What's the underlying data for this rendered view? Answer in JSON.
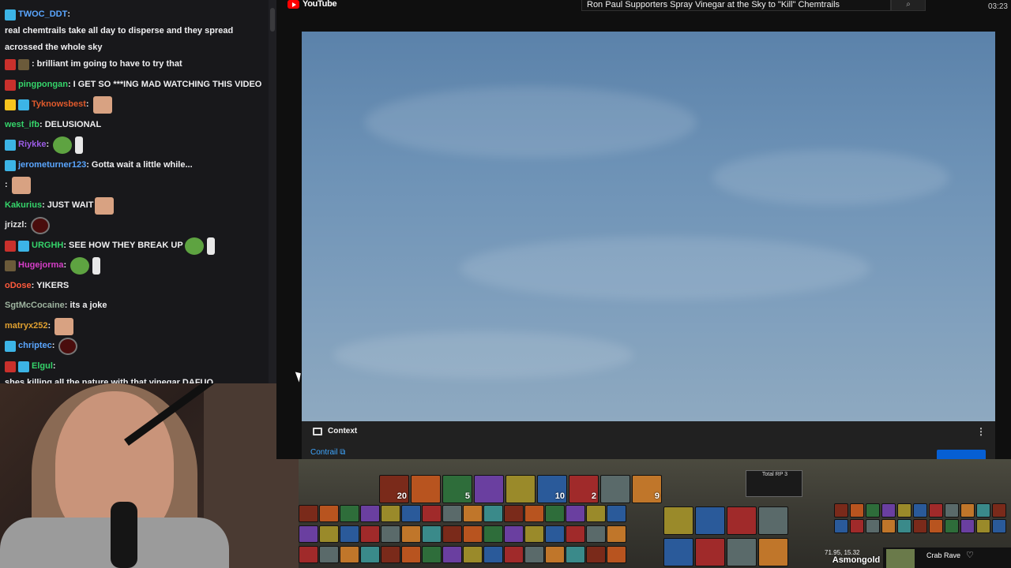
{
  "chat": {
    "messages": [
      {
        "badges": [
          "sub"
        ],
        "user": "TWOC_DDT",
        "color": "#5aa6ff",
        "text": "real chemtrails take all day to disperse and they spread acrossed the whole sky",
        "emotes": []
      },
      {
        "badges": [
          "mod",
          "year"
        ],
        "user": "",
        "color": "#444444",
        "text": "brilliant im going to have to try that",
        "emotes": []
      },
      {
        "badges": [
          "mod"
        ],
        "user": "pingpongan",
        "color": "#35d46a",
        "text": "I GET SO ***ING MAD WATCHING THIS VIDEO",
        "emotes": []
      },
      {
        "badges": [
          "gold",
          "sub"
        ],
        "user": "Tyknowsbest",
        "color": "#e05a2c",
        "text": "",
        "emotes": [
          "face"
        ]
      },
      {
        "badges": [],
        "user": "west_ifb",
        "color": "#35d46a",
        "text": "DELUSIONAL",
        "emotes": []
      },
      {
        "badges": [
          "sub"
        ],
        "user": "Riykke",
        "color": "#9b5ce6",
        "text": "",
        "emotes": [
          "pepe",
          "feather"
        ]
      },
      {
        "badges": [
          "sub"
        ],
        "user": "jerometurner123",
        "color": "#5aa6ff",
        "text": "Gotta wait a little while...",
        "emotes": []
      },
      {
        "badges": [],
        "user": "",
        "color": "#b22222",
        "text": "",
        "emotes": [
          "face"
        ]
      },
      {
        "badges": [],
        "user": "Kakurius",
        "color": "#35d46a",
        "text": "JUST WAIT",
        "emotes": [
          "face"
        ]
      },
      {
        "badges": [],
        "user": "jrizzl",
        "color": "#e0e0e0",
        "text": "",
        "emotes": [
          "orb"
        ]
      },
      {
        "badges": [
          "mod",
          "sub"
        ],
        "user": "URGHH",
        "color": "#35d46a",
        "text": "SEE HOW THEY BREAK UP",
        "emotes": [
          "pepe",
          "feather"
        ]
      },
      {
        "badges": [
          "year"
        ],
        "user": "Hugejorma",
        "color": "#d63ec8",
        "text": "",
        "emotes": [
          "pepe",
          "feather"
        ]
      },
      {
        "badges": [],
        "user": "oDose",
        "color": "#ff5a3c",
        "text": "YIKERS",
        "emotes": []
      },
      {
        "badges": [],
        "user": "SgtMcCocaine",
        "color": "#9fb4a0",
        "text": "its a joke",
        "emotes": []
      },
      {
        "badges": [],
        "user": "matryx252",
        "color": "#e0a030",
        "text": "",
        "emotes": [
          "face"
        ]
      },
      {
        "badges": [
          "sub"
        ],
        "user": "chriptec",
        "color": "#5aa6ff",
        "text": "",
        "emotes": [
          "orb"
        ]
      },
      {
        "badges": [
          "mod",
          "sub"
        ],
        "user": "Elgul",
        "color": "#35d46a",
        "text": "shes killing all the nature with that vinegar DAFUQ",
        "emotes": []
      }
    ]
  },
  "browser": {
    "site_name": "YouTube",
    "search_value": "Ron Paul Supporters Spray Vinegar at the Sky to \"Kill\" Chemtrails",
    "clock": "03:23"
  },
  "context": {
    "title": "Context",
    "link": "Contrail ⧉",
    "menu": "⋮"
  },
  "game": {
    "total_rp_label": "Total RP 3",
    "coords": "71.95, 15.32",
    "player": "Asmongold",
    "bar_counts": [
      "20",
      "",
      "5",
      "",
      "",
      "10",
      "2",
      "",
      "9"
    ]
  },
  "spotify": {
    "track": "Crab Rave",
    "heart": "♡"
  }
}
